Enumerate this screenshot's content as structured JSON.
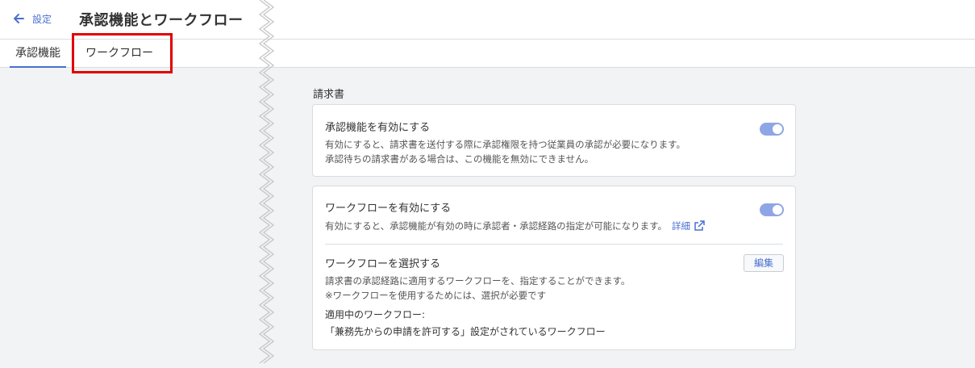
{
  "header": {
    "back_label": "設定",
    "title": "承認機能とワークフロー"
  },
  "tabs": [
    {
      "label": "承認機能",
      "active": true
    },
    {
      "label": "ワークフロー",
      "active": false
    }
  ],
  "section": {
    "title": "請求書"
  },
  "approval_card": {
    "title": "承認機能を有効にする",
    "desc_line1": "有効にすると、請求書を送付する際に承認権限を持つ従業員の承認が必要になります。",
    "desc_line2": "承認待ちの請求書がある場合は、この機能を無効にできません。",
    "enabled": true
  },
  "workflow_card": {
    "title": "ワークフローを有効にする",
    "desc": "有効にすると、承認機能が有効の時に承認者・承認経路の指定が可能になります。",
    "detail_link": "詳細",
    "enabled": true,
    "select_title": "ワークフローを選択する",
    "edit_label": "編集",
    "select_desc_line1": "請求書の承認経路に適用するワークフローを、指定することができます。",
    "select_desc_line2": "※ワークフローを使用するためには、選択が必要です",
    "applied_label": "適用中のワークフロー:",
    "applied_value": "「兼務先からの申請を許可する」設定がされているワークフロー"
  },
  "colors": {
    "accent": "#4a6fd1",
    "toggle_on": "#8fa6e6",
    "highlight": "#e00000"
  }
}
